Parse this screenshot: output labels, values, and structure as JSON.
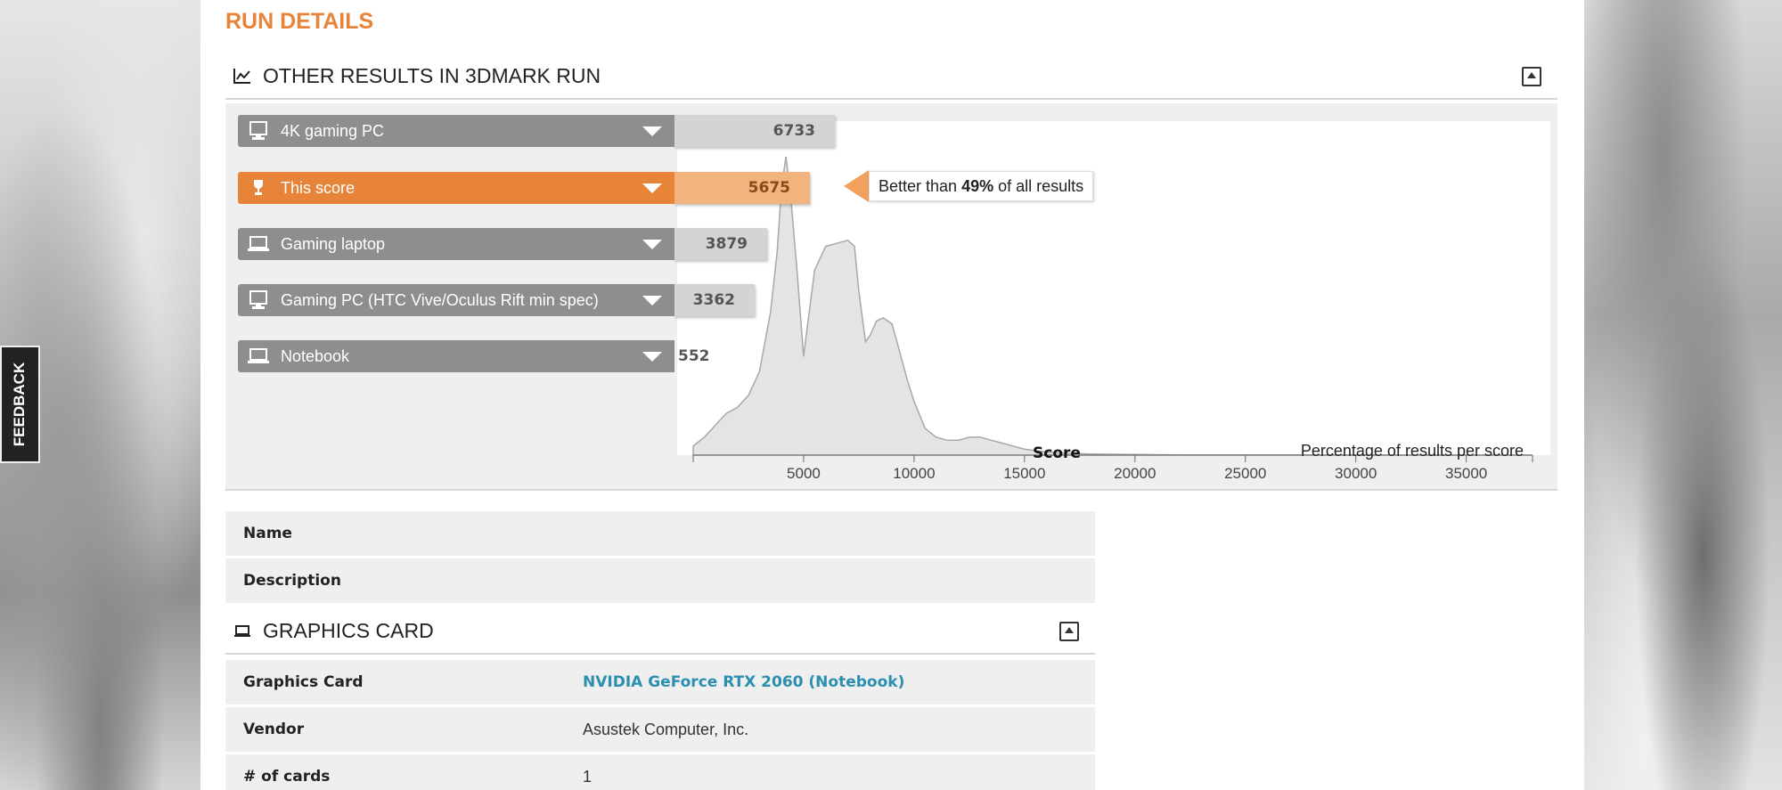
{
  "page": {
    "run_details_title": "RUN DETAILS",
    "feedback_label": "FEEDBACK"
  },
  "other_results": {
    "title": "OTHER RESULTS IN 3DMARK RUN",
    "rows": [
      {
        "label": "4K gaming PC",
        "score": "6733",
        "value": 6733,
        "icon": "desktop-icon",
        "active": false
      },
      {
        "label": "This score",
        "score": "5675",
        "value": 5675,
        "icon": "trophy-icon",
        "active": true
      },
      {
        "label": "Gaming laptop",
        "score": "3879",
        "value": 3879,
        "icon": "laptop-icon",
        "active": false
      },
      {
        "label": "Gaming PC (HTC Vive/Oculus Rift min spec)",
        "score": "3362",
        "value": 3362,
        "icon": "desktop-icon",
        "active": false
      },
      {
        "label": "Notebook",
        "score": "552",
        "value": 552,
        "icon": "laptop-icon",
        "active": false
      }
    ],
    "tooltip": {
      "prefix": "Better than",
      "percent": "49%",
      "suffix": "of all results"
    }
  },
  "chart_data": {
    "type": "area",
    "xlabel": "Score",
    "ylabel": "Percentage of results per score",
    "xlim": [
      0,
      38000
    ],
    "x_ticks": [
      5000,
      10000,
      15000,
      20000,
      25000,
      30000,
      35000
    ],
    "x_tick_labels": [
      "5000",
      "10000",
      "15000",
      "20000",
      "25000",
      "30000",
      "35000"
    ],
    "x": [
      0,
      500,
      1000,
      1500,
      2000,
      2500,
      3000,
      3500,
      3800,
      4000,
      4200,
      4400,
      4700,
      5000,
      5200,
      5500,
      6000,
      6500,
      7000,
      7300,
      7500,
      7800,
      8000,
      8300,
      8600,
      9000,
      9300,
      9700,
      10000,
      10500,
      11000,
      11500,
      12000,
      12500,
      13000,
      13500,
      14000,
      15000,
      16000,
      17000,
      18000,
      20000,
      22000,
      25000,
      30000,
      35000,
      38000
    ],
    "y": [
      3,
      6,
      10,
      14,
      16,
      20,
      28,
      48,
      68,
      90,
      100,
      88,
      62,
      33,
      45,
      62,
      70,
      71,
      72,
      70,
      55,
      38,
      40,
      45,
      46,
      44,
      36,
      25,
      18,
      9,
      6,
      5,
      5,
      6,
      6,
      5,
      4,
      2,
      1,
      0.6,
      0.4,
      0.2,
      0.1,
      0.05,
      0.02,
      0.01,
      0
    ],
    "colors": {
      "fill": "#e4e4e4",
      "stroke": "#a8a8a8"
    }
  },
  "info": {
    "name_key": "Name",
    "description_key": "Description"
  },
  "graphics_card": {
    "title": "GRAPHICS CARD",
    "rows": [
      {
        "key": "Graphics Card",
        "value": "NVIDIA GeForce RTX 2060 (Notebook)",
        "link": true
      },
      {
        "key": "Vendor",
        "value": "Asustek Computer, Inc.",
        "link": false
      },
      {
        "key": "# of cards",
        "value": "1",
        "link": false
      }
    ]
  },
  "colors": {
    "accent": "#e8833a",
    "link": "#2b8fb0"
  }
}
